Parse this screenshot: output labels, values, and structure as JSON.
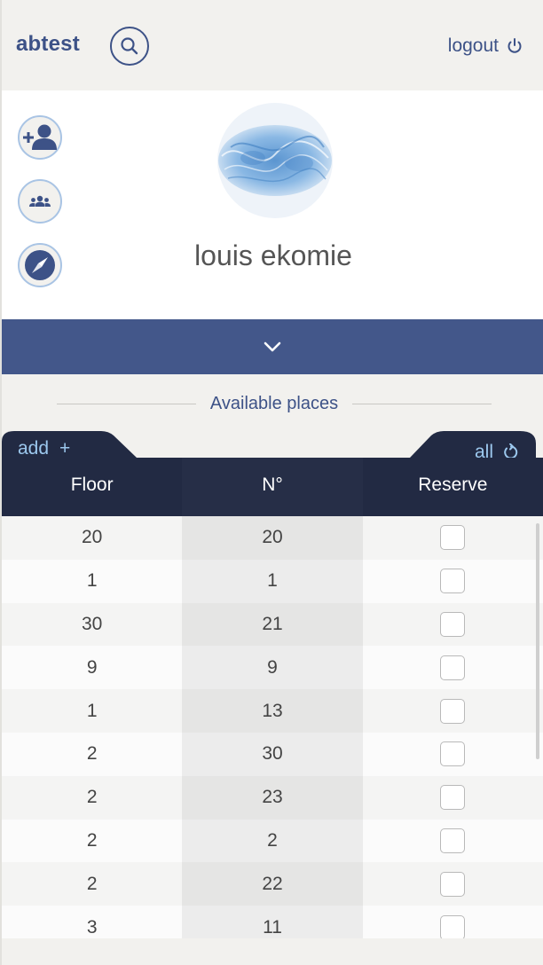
{
  "header": {
    "brand": "abtest",
    "logout_label": "logout",
    "search_icon": "search-icon",
    "power_icon": "power-icon"
  },
  "profile": {
    "name": "louis ekomie",
    "actions": [
      {
        "icon": "add-user-icon"
      },
      {
        "icon": "group-icon"
      },
      {
        "icon": "compass-icon"
      }
    ]
  },
  "section": {
    "title": "Available places"
  },
  "table": {
    "add_label": "add",
    "add_icon": "+",
    "all_label": "all",
    "columns": [
      "Floor",
      "N°",
      "Reserve"
    ],
    "rows": [
      {
        "floor": "20",
        "number": "20",
        "reserved": false
      },
      {
        "floor": "1",
        "number": "1",
        "reserved": false
      },
      {
        "floor": "30",
        "number": "21",
        "reserved": false
      },
      {
        "floor": "9",
        "number": "9",
        "reserved": false
      },
      {
        "floor": "1",
        "number": "13",
        "reserved": false
      },
      {
        "floor": "2",
        "number": "30",
        "reserved": false
      },
      {
        "floor": "2",
        "number": "23",
        "reserved": false
      },
      {
        "floor": "2",
        "number": "2",
        "reserved": false
      },
      {
        "floor": "2",
        "number": "22",
        "reserved": false
      },
      {
        "floor": "3",
        "number": "11",
        "reserved": false
      }
    ]
  },
  "colors": {
    "brand": "#3d5287",
    "header_dark": "#222a43",
    "accent_light": "#9cc8ee"
  }
}
